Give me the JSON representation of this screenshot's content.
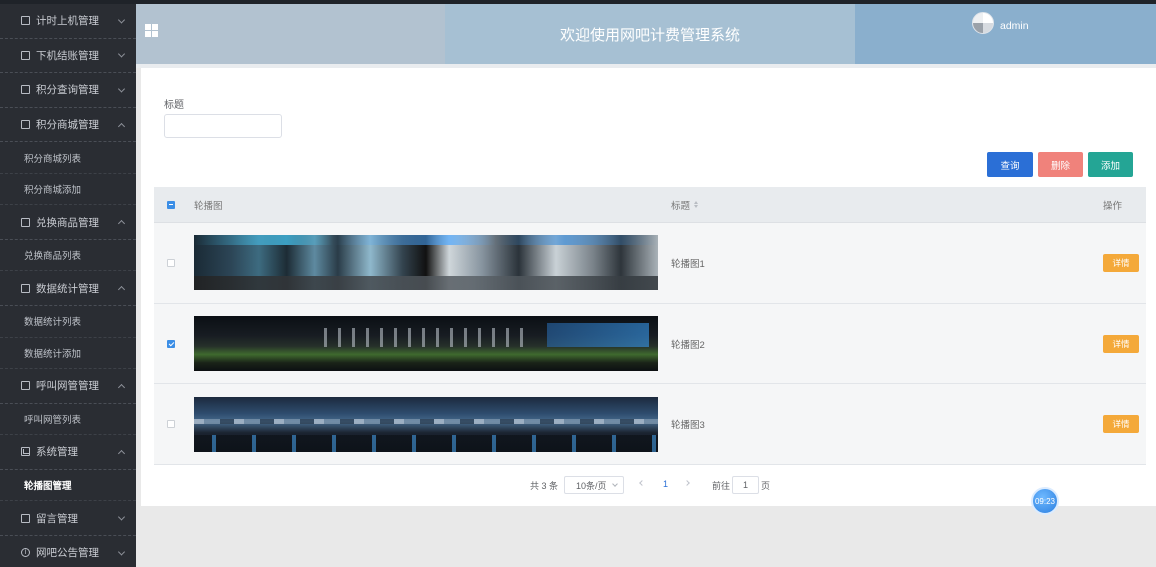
{
  "sidebar": {
    "items": [
      {
        "label": "计时上机管理",
        "expanded": false,
        "icon": "edit-icon",
        "children": []
      },
      {
        "label": "下机结账管理",
        "expanded": false,
        "icon": "edit-icon",
        "children": []
      },
      {
        "label": "积分查询管理",
        "expanded": false,
        "icon": "edit-icon",
        "children": []
      },
      {
        "label": "积分商城管理",
        "expanded": true,
        "icon": "edit-icon",
        "children": [
          "积分商城列表",
          "积分商城添加"
        ]
      },
      {
        "label": "兑换商品管理",
        "expanded": true,
        "icon": "edit-icon",
        "children": [
          "兑换商品列表"
        ]
      },
      {
        "label": "数据统计管理",
        "expanded": true,
        "icon": "edit-icon",
        "children": [
          "数据统计列表",
          "数据统计添加"
        ]
      },
      {
        "label": "呼叫网管管理",
        "expanded": true,
        "icon": "edit-icon",
        "children": [
          "呼叫网管列表"
        ]
      },
      {
        "label": "系统管理",
        "expanded": true,
        "icon": "chart-icon",
        "children": [
          "轮播图管理"
        ]
      },
      {
        "label": "留言管理",
        "expanded": false,
        "icon": "edit-icon",
        "children": []
      },
      {
        "label": "网吧公告管理",
        "expanded": false,
        "icon": "info-icon",
        "children": []
      }
    ],
    "active_child": "轮播图管理"
  },
  "header": {
    "title": "欢迎使用网吧计费管理系统",
    "username": "admin"
  },
  "search": {
    "label": "标题",
    "value": ""
  },
  "actions": {
    "query": "查询",
    "delete": "删除",
    "add": "添加"
  },
  "table": {
    "columns": [
      "轮播图",
      "标题",
      "操作"
    ],
    "rows": [
      {
        "title": "轮播图1",
        "checked": false,
        "action": "详情"
      },
      {
        "title": "轮播图2",
        "checked": true,
        "action": "详情"
      },
      {
        "title": "轮播图3",
        "checked": false,
        "action": "详情"
      }
    ]
  },
  "pagination": {
    "total": "共 3 条",
    "page_size": "10条/页",
    "current_page": "1",
    "goto_label": "前往",
    "goto_value": "1",
    "goto_unit": "页"
  },
  "clock": "09:23",
  "colors": {
    "sidebar_bg": "#2a2d33",
    "query_button": "#2b6fd6",
    "delete_button": "#f0827b",
    "add_button": "#24a595",
    "detail_button": "#f4a93a"
  }
}
